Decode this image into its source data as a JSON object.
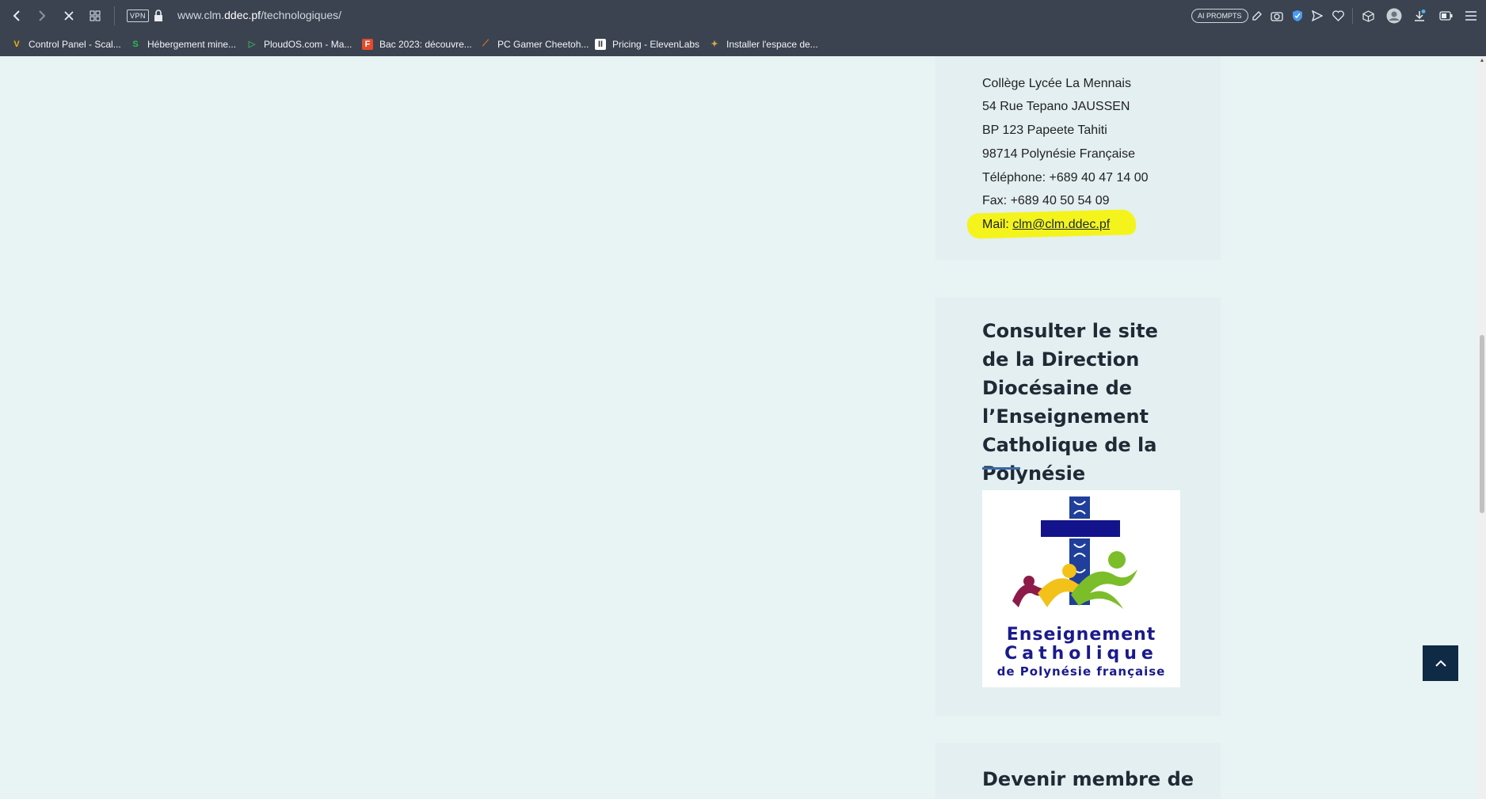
{
  "browser": {
    "url_prefix": "www.clm.",
    "url_host": "ddec.pf",
    "url_path": "/technologiques/",
    "vpn_label": "VPN",
    "ai_prompts_label": "AI PROMPTS",
    "bookmarks": [
      {
        "label": "Control Panel - Scal...",
        "icon": "V"
      },
      {
        "label": "Hébergement mine...",
        "icon": "S"
      },
      {
        "label": "PloudOS.com - Ma...",
        "icon": "▷"
      },
      {
        "label": "Bac 2023: découvre...",
        "icon": "F"
      },
      {
        "label": "PC Gamer Cheetoh...",
        "icon": "⟋"
      },
      {
        "label": "Pricing - ElevenLabs",
        "icon": "II"
      },
      {
        "label": "Installer l'espace de...",
        "icon": "✦"
      }
    ]
  },
  "address_widget": {
    "lines": [
      "Collège Lycée La Mennais",
      "54 Rue Tepano JAUSSEN",
      "BP 123 Papeete Tahiti",
      "98714 Polynésie Française",
      "Téléphone: +689 40 47 14 00",
      "Fax: +689 40 50 54 09"
    ],
    "mail_label": "Mail: ",
    "mail_link": "clm@clm.ddec.pf",
    "highlight_color": "#f4f41c"
  },
  "diocese_widget": {
    "title": "Consulter le site de la Direction Diocésaine de l’Enseignement Catholique de la Polynésie Française",
    "logo_line1": "Enseignement",
    "logo_line2": "Catholique",
    "logo_line3": "de Polynésie française"
  },
  "member_widget": {
    "title": "Devenir membre de"
  },
  "colors": {
    "page_bg": "#e8f3f3",
    "widget_bg": "#e3eff0",
    "topbar_bg": "#3b4350",
    "accent": "#3a6aa8",
    "back_to_top_bg": "#0f2a45"
  }
}
